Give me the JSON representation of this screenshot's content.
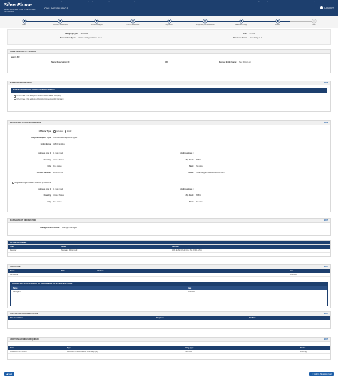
{
  "header": {
    "logo_title": "SilverFlume",
    "logo_subtitle": "Nevada's Business Portal to start/manage your business",
    "app_title": "ONLINE FILINGS",
    "nav": [
      "My Profile",
      "Pending Filings",
      "Entity Search",
      "Licensing & Permits",
      "Business Formation",
      "Amendments",
      "Annual Lists",
      "Reinstatements and Revival",
      "Commercial Recordings",
      "Copies and Certificates",
      "Name Reservations",
      "Mergers & Conversions"
    ],
    "logout": "LOGOUT"
  },
  "steps": [
    {
      "label": "Name",
      "done": true
    },
    {
      "label": "Business Information",
      "done": true
    },
    {
      "label": "Registered Agent",
      "done": true
    },
    {
      "label": "Officer Information",
      "done": true
    },
    {
      "label": "Signature",
      "done": true
    },
    {
      "label": "Supporting Documentation",
      "done": true
    },
    {
      "label": "Additional Filings",
      "done": true
    },
    {
      "label": "Review",
      "done": true
    },
    {
      "label": "Done",
      "done": false
    }
  ],
  "summary": {
    "category_label": "Category Type:",
    "category_value": "Business",
    "transaction_label": "Transaction Type:",
    "transaction_value": "Articles of Organization - LLC",
    "fee_label": "Fee:",
    "fee_value": "$75.00",
    "business_name_label": "Business Name:",
    "business_name_value": "New Filing LLC"
  },
  "name_availability": {
    "title": "NAME AVAILABILITY SEARCH",
    "search_by_label": "Search By:",
    "reservation_label": "Name Reservation ID:",
    "reservation_value": "",
    "or_label": "OR",
    "entity_name_label": "Desired Entity Name:",
    "entity_name_value": "New Filing LLC"
  },
  "business_information": {
    "title": "BUSINESS INFORMATION",
    "edit": "EDIT",
    "sub_title": "SERIES / RESTRICTED LIMITED LIABILITY COMPANY",
    "options": [
      "Check here if this entity is a Series Limited-Liability Company",
      "Check here if this entity is a Restricted Limited-Liability Company"
    ]
  },
  "registered_agent": {
    "title": "REGISTERED AGENT INFORMATION",
    "edit": "EDIT",
    "ra_name_type_label": "RA Name Type:",
    "ra_name_type_options": [
      "Individual",
      "Entity"
    ],
    "ra_type_label": "Registered Agent Type:",
    "ra_type_value": "Commercial Registered Agent",
    "entity_name_label": "Entity Name:",
    "entity_name_value": "ABCD Entities",
    "address1_label": "Address Line 1:",
    "address1_value": "1 main road",
    "address2_label": "Address Line 2:",
    "address2_value": "",
    "country_label": "Country:",
    "country_value": "United States",
    "zip_label": "Zip Code:",
    "zip_value": "89801",
    "city_label": "City:",
    "city_value": "Fun Lakes",
    "state_label": "State:",
    "state_value": "Nevada",
    "phone_label": "Contact Number:",
    "phone_value": "2222467890",
    "email_label": "Email:",
    "email_value": "TesEmail@EmailAddressProxy.com",
    "mailing_label": "Registered Agent Mailing Address (If Different)",
    "m_address1_label": "Address Line 1:",
    "m_address1_value": "1 main road",
    "m_address2_label": "Address Line 2:",
    "m_address2_value": "",
    "m_country_label": "Country:",
    "m_country_value": "United States",
    "m_zip_label": "Zip Code:",
    "m_zip_value": "89801",
    "m_city_label": "City:",
    "m_city_value": "Fun Lakes",
    "m_state_label": "State:",
    "m_state_value": "Nevada"
  },
  "management": {
    "title": "MANAGEMENT INFORMATION",
    "edit": "EDIT",
    "structure_label": "Management Structure:",
    "structure_value": "Manager Managed"
  },
  "acting_by": {
    "title": "ACTING BY/UNDER",
    "columns": [
      "Title",
      "Name",
      "Address"
    ],
    "rows": [
      [
        "Manager",
        "Nevadan, Williams Jr.",
        "1234 E. St. Cheri, City, NV 89701, USA"
      ]
    ]
  },
  "signature": {
    "title": "SIGNATURE",
    "edit": "EDIT",
    "columns": [
      "Name",
      "Title",
      "Address",
      "Date"
    ],
    "rows": [
      [
        "John Fake",
        "",
        "",
        "6/30/2019"
      ]
    ]
  },
  "certificate": {
    "title": "CERTIFICATE OF ACCEPTANCE OF APPOINTMENT OF REGISTERED AGENT",
    "columns": [
      "Name",
      "Date"
    ],
    "rows": [
      [
        "Joe Agent",
        "6/30/2019"
      ]
    ]
  },
  "supporting_docs": {
    "title": "SUPPORTING DOCUMENTATION",
    "edit": "EDIT",
    "columns": [
      "File Description",
      "Required",
      "File Size"
    ],
    "rows": []
  },
  "additional_filings": {
    "title": "ADDITIONAL FILINGS REQUIRED",
    "edit": "EDIT",
    "columns": [
      "Date",
      "Type",
      "Filing Type",
      "Status"
    ],
    "rows": [
      [
        "6/30/2019 3:21:33 PM",
        "Domestic Limited-Liability Company (86)",
        "Initial List",
        "Pending"
      ]
    ]
  },
  "footer": {
    "back": "Back",
    "next": "Add to Shopping Cart"
  }
}
